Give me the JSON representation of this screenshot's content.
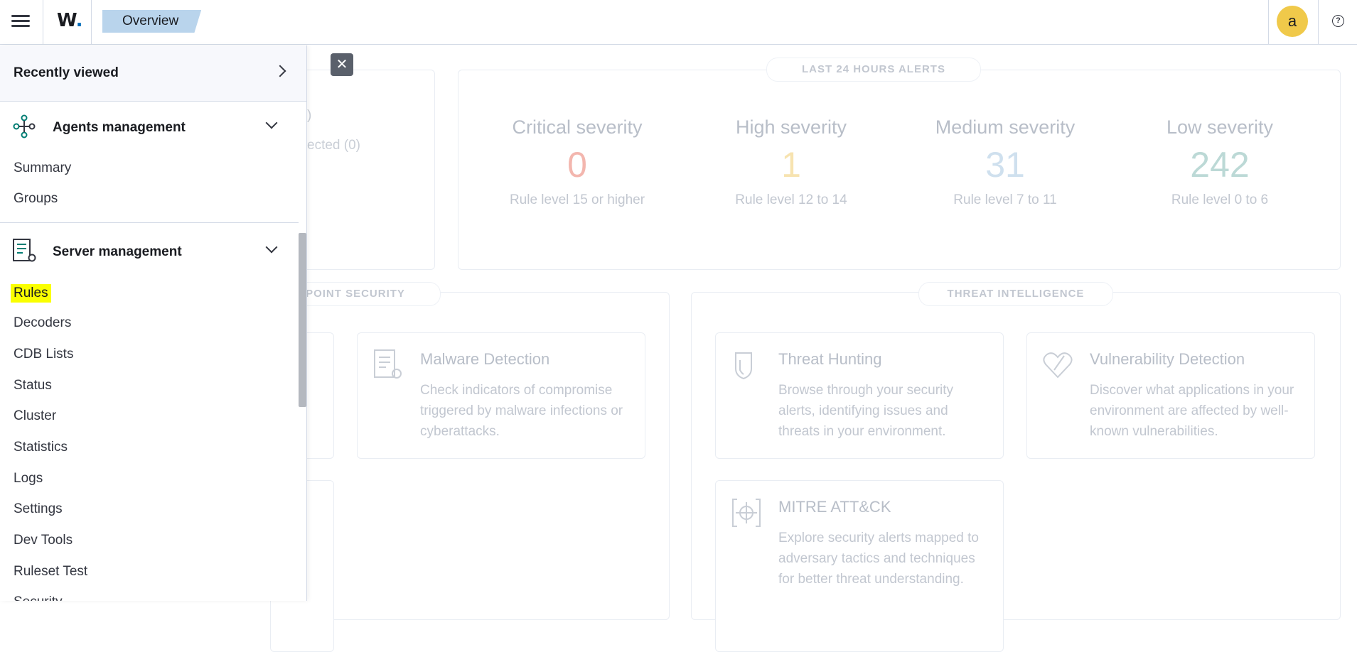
{
  "header": {
    "logo_text": "W",
    "logo_dot": ".",
    "breadcrumb": "Overview",
    "avatar_initial": "a",
    "help_glyph": "?"
  },
  "flyout": {
    "recently_viewed": "Recently viewed",
    "groups": [
      {
        "label": "Agents management",
        "icon": "agents-icon",
        "items": [
          "Summary",
          "Groups"
        ]
      },
      {
        "label": "Server management",
        "icon": "server-management-icon",
        "items": [
          "Rules",
          "Decoders",
          "CDB Lists",
          "Status",
          "Cluster",
          "Statistics",
          "Logs",
          "Settings",
          "Dev Tools",
          "Ruleset Test",
          "Security"
        ],
        "active": "Rules"
      }
    ],
    "close_glyph": "✕"
  },
  "background": {
    "agents_partial": [
      ")",
      "ected (0)"
    ],
    "alerts_title": "LAST 24 HOURS ALERTS",
    "severities": [
      {
        "title": "Critical severity",
        "value": "0",
        "sub": "Rule level 15 or higher",
        "color": "#f3b6ae"
      },
      {
        "title": "High severity",
        "value": "1",
        "sub": "Rule level 12 to 14",
        "color": "#f7e3b0"
      },
      {
        "title": "Medium severity",
        "value": "31",
        "sub": "Rule level 7 to 11",
        "color": "#cfe0ee"
      },
      {
        "title": "Low severity",
        "value": "242",
        "sub": "Rule level 0 to 6",
        "color": "#bcd9d6"
      }
    ],
    "endpoint_title": "POINT SECURITY",
    "threat_title": "THREAT INTELLIGENCE",
    "cards": [
      {
        "title": "Malware Detection",
        "desc": "Check indicators of compromise triggered by malware infections or cyberattacks.",
        "icon": "malware-detection-icon"
      },
      {
        "title": "Threat Hunting",
        "desc": "Browse through your security alerts, identifying issues and threats in your environment.",
        "icon": "threat-hunting-icon"
      },
      {
        "title": "Vulnerability Detection",
        "desc": "Discover what applications in your environment are affected by well-known vulnerabilities.",
        "icon": "vulnerability-icon"
      },
      {
        "title": "MITRE ATT&CK",
        "desc": "Explore security alerts mapped to adversary tactics and techniques for better threat understanding.",
        "icon": "mitre-icon"
      }
    ]
  }
}
